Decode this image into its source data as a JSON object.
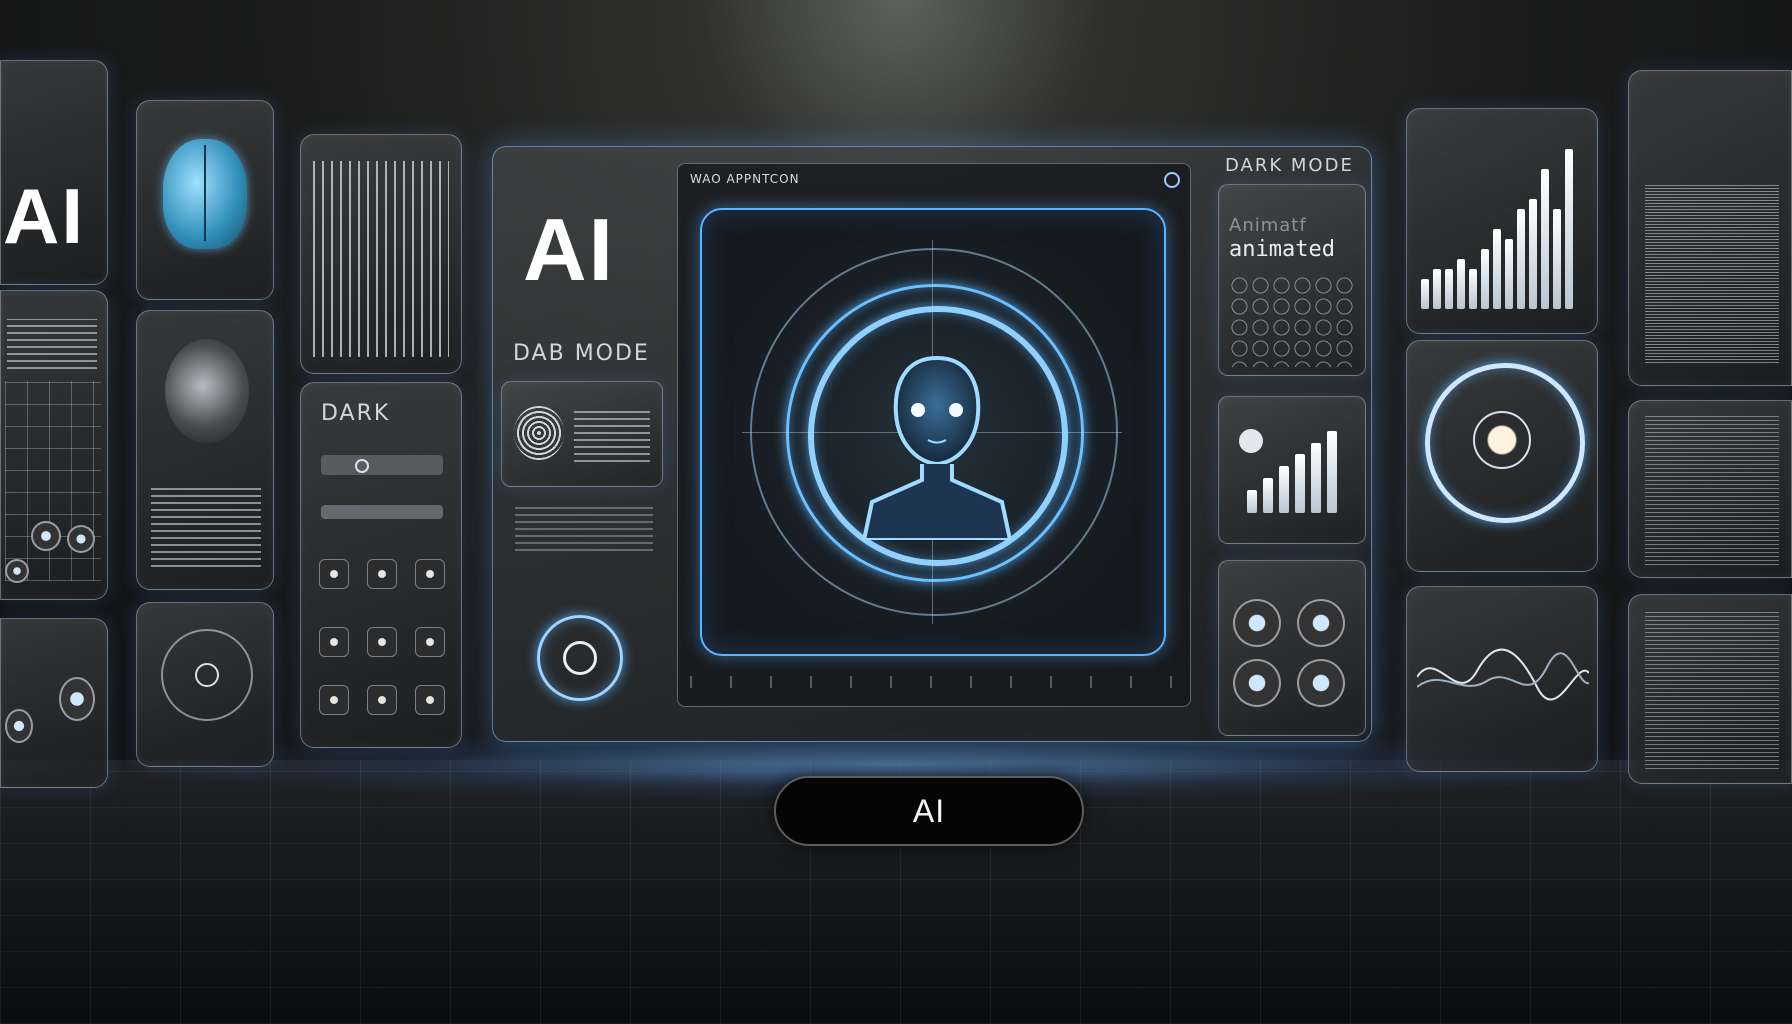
{
  "left_wall": {
    "panel_ai_label": "AI",
    "dark_label": "DARK"
  },
  "center_console": {
    "big_ai_label": "AI",
    "mode_label": "DAB MODE",
    "window_title": "WAO APPNTCON"
  },
  "right_panel": {
    "dark_mode_label": "DARK MODE",
    "animate_label_top": "Animatf",
    "animate_label_bottom": "animated"
  },
  "primary_button": {
    "label": "AI"
  },
  "colors": {
    "accent_glow": "#6cc0ff",
    "background": "#1d1e1d",
    "button_bg": "#050506"
  },
  "chart_right": {
    "type": "bar",
    "values": [
      3,
      4,
      4,
      5,
      4,
      6,
      8,
      7,
      10,
      11,
      14,
      10,
      16
    ]
  },
  "chart_small": {
    "type": "bar",
    "values": [
      2,
      3,
      4,
      5,
      6,
      7
    ]
  }
}
